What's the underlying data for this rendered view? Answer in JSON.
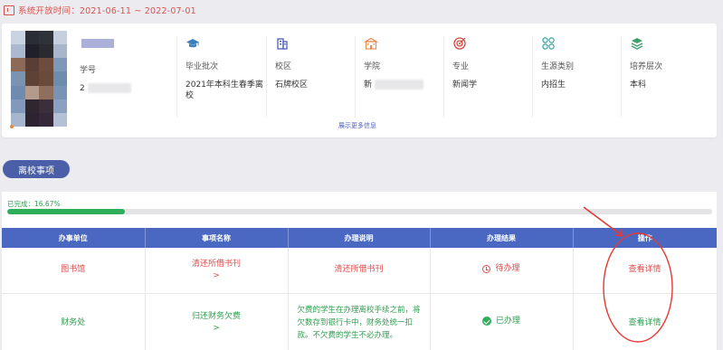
{
  "system_open": {
    "text": "系统开放时间：2021-06-11 ~ 2022-07-01",
    "icon": "calendar-icon"
  },
  "profile": {
    "fields": [
      {
        "key": "student_id",
        "label": "学号",
        "value": "2",
        "icon": "id-icon"
      },
      {
        "key": "grad_batch",
        "label": "毕业批次",
        "value": "2021年本科生春季离校",
        "icon": "graduation-cap-icon"
      },
      {
        "key": "campus",
        "label": "校区",
        "value": "石牌校区",
        "icon": "building-icon"
      },
      {
        "key": "college",
        "label": "学院",
        "value": "新",
        "icon": "school-icon"
      },
      {
        "key": "major",
        "label": "专业",
        "value": "新闻学",
        "icon": "target-icon"
      },
      {
        "key": "origin",
        "label": "生源类别",
        "value": "内招生",
        "icon": "grid-icon"
      },
      {
        "key": "level",
        "label": "培养层次",
        "value": "本科",
        "icon": "layers-icon"
      }
    ],
    "more_link": "展示更多信息"
  },
  "section_tab": {
    "label": "离校事项"
  },
  "progress": {
    "label": "已完成：16.67%",
    "percent": 16.67
  },
  "table": {
    "headers": [
      "办事单位",
      "事项名称",
      "办理说明",
      "办理结果",
      "操作"
    ],
    "rows": [
      {
        "unit": "图书馆",
        "item": "清还所借书刊",
        "item_arrow": ">",
        "description": "清还所借书刊",
        "result": "待办理",
        "action": "查看详情",
        "tone": "red"
      },
      {
        "unit": "财务处",
        "item": "归还财务欠费",
        "item_arrow": ">",
        "description": "欠费的学生在办理离校手续之前，将欠数存到银行卡中，财务处统一扣款。不欠费的学生不必办理。",
        "result": "已办理",
        "action": "查看详情",
        "tone": "green"
      }
    ]
  },
  "colors": {
    "primary": "#4a68c1",
    "pill": "#4a5fa8",
    "danger": "#e04b4b",
    "success": "#2eae5a",
    "annotation": "#e53935"
  }
}
